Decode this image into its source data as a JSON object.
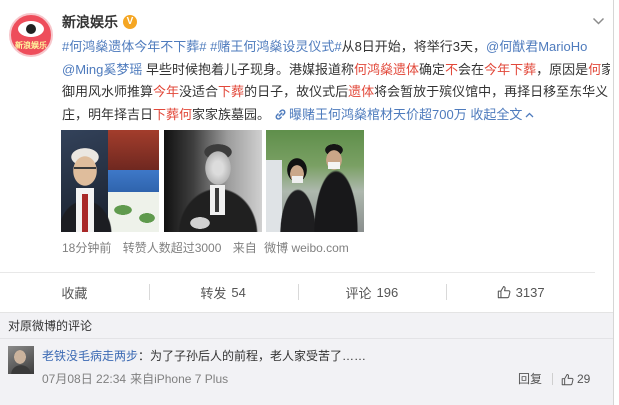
{
  "post": {
    "author": {
      "name": "新浪娱乐",
      "verified_letter": "V",
      "logo_text": "新浪娱乐"
    },
    "lines": [
      [
        {
          "t": "hashtag",
          "text": "#何鸿燊遗体今年不下葬#"
        },
        {
          "t": "plain",
          "text": " "
        },
        {
          "t": "hashtag",
          "text": "#赌王何鸿燊设灵仪式#"
        },
        {
          "t": "plain",
          "text": "从8日开始，将举行3天，"
        },
        {
          "t": "mention",
          "text": "@何猷君MarioHo"
        }
      ],
      [
        {
          "t": "mention",
          "text": "@Ming奚梦瑶"
        },
        {
          "t": "plain",
          "text": " 早些时候抱着儿子现身。港媒报道称"
        },
        {
          "t": "highlight",
          "text": "何鸿燊遗体"
        },
        {
          "t": "plain",
          "text": "确定"
        },
        {
          "t": "highlight",
          "text": "不"
        },
        {
          "t": "plain",
          "text": "会在"
        },
        {
          "t": "highlight",
          "text": "今年下葬"
        },
        {
          "t": "plain",
          "text": "，原因是"
        },
        {
          "t": "highlight",
          "text": "何"
        },
        {
          "t": "plain",
          "text": "家"
        }
      ],
      [
        {
          "t": "plain",
          "text": "御用风水师推算"
        },
        {
          "t": "highlight",
          "text": "今年"
        },
        {
          "t": "plain",
          "text": "没适合"
        },
        {
          "t": "highlight",
          "text": "下葬"
        },
        {
          "t": "plain",
          "text": "的日子，故仪式后"
        },
        {
          "t": "highlight",
          "text": "遗体"
        },
        {
          "t": "plain",
          "text": "将会暂放于殡仪馆中，再择日移至东华义"
        }
      ],
      [
        {
          "t": "plain",
          "text": "庄，明年择吉日"
        },
        {
          "t": "highlight",
          "text": "下葬何"
        },
        {
          "t": "plain",
          "text": "家家族墓园。"
        },
        {
          "t": "icon",
          "icon": "link-icon"
        },
        {
          "t": "link",
          "text": "曝赌王何鸿燊棺材天价超700万"
        },
        {
          "t": "plain",
          "text": " "
        },
        {
          "t": "collapse",
          "text": "收起全文"
        },
        {
          "t": "icon",
          "icon": "chevron-up-icon"
        }
      ]
    ],
    "meta": {
      "time": "18分钟前",
      "stats": "转赞人数超过3000",
      "source_label": "来自",
      "source": "微博 weibo.com"
    },
    "actions": {
      "favorite": {
        "label": "收藏"
      },
      "repost": {
        "label": "转发",
        "count": "54"
      },
      "comment": {
        "label": "评论",
        "count": "196"
      },
      "like": {
        "icon": "thumbs-up-icon",
        "count": "3137"
      }
    }
  },
  "comments": {
    "header": "对原微博的评论",
    "items": [
      {
        "user": "老铁没毛病走两步",
        "text": "：为了子孙后人的前程，老人家受苦了……",
        "time": "07月08日 22:34",
        "source": "来自iPhone 7 Plus",
        "reply_label": "回复",
        "like_icon": "thumbs-up-icon",
        "likes": "29"
      }
    ]
  },
  "icons": {
    "more": "chevron-down-icon",
    "verified": "verified-badge-icon",
    "article_link": "link-icon",
    "collapse": "chevron-up-icon",
    "like": "thumbs-up-icon"
  },
  "colors": {
    "link": "#4e7bbd",
    "highlight": "#e2483a",
    "text": "#333333",
    "muted": "#808080",
    "badge": "#f5a623",
    "username": "#3d6bb4",
    "panel": "#f2f2f5"
  }
}
